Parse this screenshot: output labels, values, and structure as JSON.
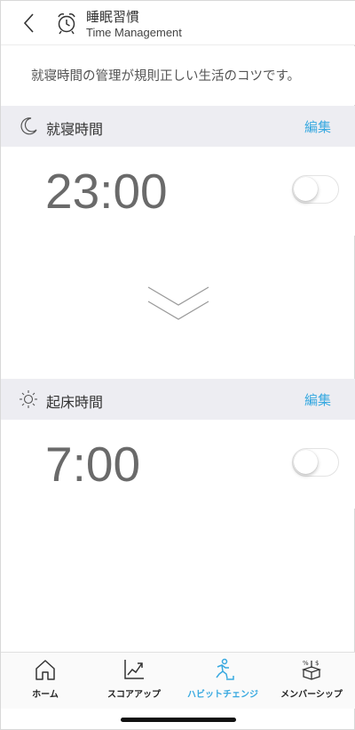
{
  "header": {
    "title_ja": "睡眠習慣",
    "title_en": "Time Management",
    "back_icon": "chevron-left-icon",
    "title_icon": "alarm-clock-icon"
  },
  "intro": {
    "text": "就寝時間の管理が規則正しい生活のコツです。"
  },
  "bedtime": {
    "icon": "moon-icon",
    "label": "就寝時間",
    "edit_label": "編集",
    "time": "23:00",
    "enabled": false
  },
  "wakeup": {
    "icon": "sun-icon",
    "label": "起床時間",
    "edit_label": "編集",
    "time": "7:00",
    "enabled": false
  },
  "tabs": [
    {
      "label": "ホーム",
      "icon": "home-icon",
      "active": false
    },
    {
      "label": "スコアアップ",
      "icon": "chart-icon",
      "active": false
    },
    {
      "label": "ハビットチェンジ",
      "icon": "running-person-icon",
      "active": true
    },
    {
      "label": "メンバーシップ",
      "icon": "gift-box-icon",
      "active": false
    }
  ],
  "colors": {
    "accent": "#38a9e0",
    "section_bg": "#ededf2",
    "time_text": "#6a6a6a"
  }
}
